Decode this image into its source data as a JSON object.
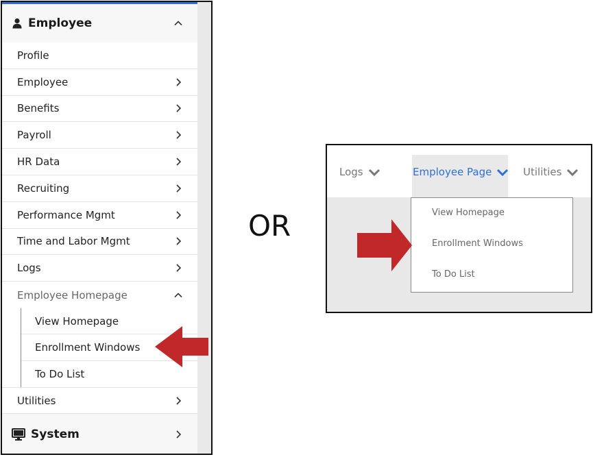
{
  "sidebar": {
    "header": {
      "title": "Employee",
      "icon": "user-icon"
    },
    "items": [
      {
        "label": "Profile",
        "chevron": "none"
      },
      {
        "label": "Employee",
        "chevron": "right"
      },
      {
        "label": "Benefits",
        "chevron": "right"
      },
      {
        "label": "Payroll",
        "chevron": "right"
      },
      {
        "label": "HR Data",
        "chevron": "right"
      },
      {
        "label": "Recruiting",
        "chevron": "right"
      },
      {
        "label": "Performance Mgmt",
        "chevron": "right"
      },
      {
        "label": "Time and Labor Mgmt",
        "chevron": "right"
      },
      {
        "label": "Logs",
        "chevron": "right"
      }
    ],
    "expanded": {
      "label": "Employee Homepage",
      "subitems": [
        "View Homepage",
        "Enrollment Windows",
        "To Do List"
      ]
    },
    "utilities": {
      "label": "Utilities"
    },
    "system": {
      "title": "System",
      "icon": "monitor-icon"
    }
  },
  "or_text": "OR",
  "topnav": {
    "items": [
      {
        "label": "Logs"
      },
      {
        "label": "Employee Page",
        "active": true
      },
      {
        "label": "Utilities"
      }
    ],
    "dropdown": [
      "View Homepage",
      "Enrollment Windows",
      "To Do List"
    ]
  },
  "colors": {
    "accent": "#2f6fd6",
    "arrow": "#c0282a"
  }
}
